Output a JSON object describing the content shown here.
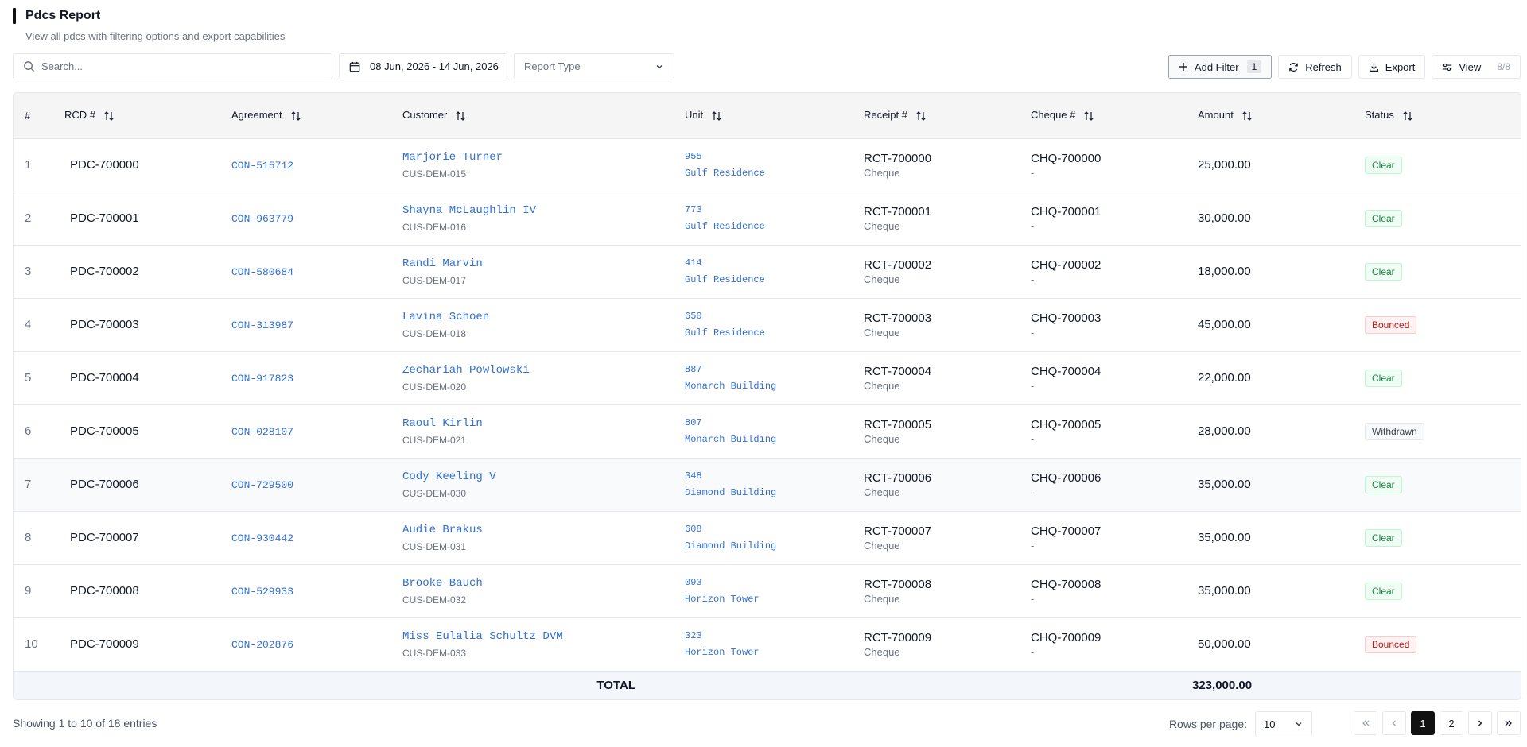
{
  "page": {
    "title": "Pdcs Report",
    "subtitle": "View all pdcs with filtering options and export capabilities"
  },
  "toolbar": {
    "search_placeholder": "Search...",
    "date_range": "08 Jun, 2026 - 14 Jun, 2026",
    "report_type_placeholder": "Report Type",
    "add_filter_label": "Add Filter",
    "filter_count": "1",
    "refresh_label": "Refresh",
    "export_label": "Export",
    "view_label": "View",
    "view_count": "8/8"
  },
  "table": {
    "headers": {
      "num": "#",
      "rcd": "RCD #",
      "agreement": "Agreement",
      "customer": "Customer",
      "unit": "Unit",
      "receipt": "Receipt #",
      "cheque": "Cheque #",
      "amount": "Amount",
      "status": "Status"
    },
    "rows": [
      {
        "num": "1",
        "rcd": "PDC-700000",
        "agreement": "CON-515712",
        "customer_name": "Marjorie Turner",
        "customer_code": "CUS-DEM-015",
        "unit_no": "955",
        "unit_building": "Gulf Residence",
        "receipt": "RCT-700000",
        "receipt_type": "Cheque",
        "cheque": "CHQ-700000",
        "cheque_sub": "-",
        "amount": "25,000.00",
        "status": "Clear"
      },
      {
        "num": "2",
        "rcd": "PDC-700001",
        "agreement": "CON-963779",
        "customer_name": "Shayna McLaughlin IV",
        "customer_code": "CUS-DEM-016",
        "unit_no": "773",
        "unit_building": "Gulf Residence",
        "receipt": "RCT-700001",
        "receipt_type": "Cheque",
        "cheque": "CHQ-700001",
        "cheque_sub": "-",
        "amount": "30,000.00",
        "status": "Clear"
      },
      {
        "num": "3",
        "rcd": "PDC-700002",
        "agreement": "CON-580684",
        "customer_name": "Randi Marvin",
        "customer_code": "CUS-DEM-017",
        "unit_no": "414",
        "unit_building": "Gulf Residence",
        "receipt": "RCT-700002",
        "receipt_type": "Cheque",
        "cheque": "CHQ-700002",
        "cheque_sub": "-",
        "amount": "18,000.00",
        "status": "Clear"
      },
      {
        "num": "4",
        "rcd": "PDC-700003",
        "agreement": "CON-313987",
        "customer_name": "Lavina Schoen",
        "customer_code": "CUS-DEM-018",
        "unit_no": "650",
        "unit_building": "Gulf Residence",
        "receipt": "RCT-700003",
        "receipt_type": "Cheque",
        "cheque": "CHQ-700003",
        "cheque_sub": "-",
        "amount": "45,000.00",
        "status": "Bounced"
      },
      {
        "num": "5",
        "rcd": "PDC-700004",
        "agreement": "CON-917823",
        "customer_name": "Zechariah Powlowski",
        "customer_code": "CUS-DEM-020",
        "unit_no": "887",
        "unit_building": "Monarch Building",
        "receipt": "RCT-700004",
        "receipt_type": "Cheque",
        "cheque": "CHQ-700004",
        "cheque_sub": "-",
        "amount": "22,000.00",
        "status": "Clear"
      },
      {
        "num": "6",
        "rcd": "PDC-700005",
        "agreement": "CON-028107",
        "customer_name": "Raoul Kirlin",
        "customer_code": "CUS-DEM-021",
        "unit_no": "807",
        "unit_building": "Monarch Building",
        "receipt": "RCT-700005",
        "receipt_type": "Cheque",
        "cheque": "CHQ-700005",
        "cheque_sub": "-",
        "amount": "28,000.00",
        "status": "Withdrawn"
      },
      {
        "num": "7",
        "rcd": "PDC-700006",
        "agreement": "CON-729500",
        "customer_name": "Cody Keeling V",
        "customer_code": "CUS-DEM-030",
        "unit_no": "348",
        "unit_building": "Diamond Building",
        "receipt": "RCT-700006",
        "receipt_type": "Cheque",
        "cheque": "CHQ-700006",
        "cheque_sub": "-",
        "amount": "35,000.00",
        "status": "Clear"
      },
      {
        "num": "8",
        "rcd": "PDC-700007",
        "agreement": "CON-930442",
        "customer_name": "Audie Brakus",
        "customer_code": "CUS-DEM-031",
        "unit_no": "608",
        "unit_building": "Diamond Building",
        "receipt": "RCT-700007",
        "receipt_type": "Cheque",
        "cheque": "CHQ-700007",
        "cheque_sub": "-",
        "amount": "35,000.00",
        "status": "Clear"
      },
      {
        "num": "9",
        "rcd": "PDC-700008",
        "agreement": "CON-529933",
        "customer_name": "Brooke Bauch",
        "customer_code": "CUS-DEM-032",
        "unit_no": "093",
        "unit_building": "Horizon Tower",
        "receipt": "RCT-700008",
        "receipt_type": "Cheque",
        "cheque": "CHQ-700008",
        "cheque_sub": "-",
        "amount": "35,000.00",
        "status": "Clear"
      },
      {
        "num": "10",
        "rcd": "PDC-700009",
        "agreement": "CON-202876",
        "customer_name": "Miss Eulalia Schultz DVM",
        "customer_code": "CUS-DEM-033",
        "unit_no": "323",
        "unit_building": "Horizon Tower",
        "receipt": "RCT-700009",
        "receipt_type": "Cheque",
        "cheque": "CHQ-700009",
        "cheque_sub": "-",
        "amount": "50,000.00",
        "status": "Bounced"
      }
    ],
    "total_label": "TOTAL",
    "total_amount": "323,000.00"
  },
  "footer": {
    "showing": "Showing 1 to 10 of 18 entries",
    "rows_per_page_label": "Rows per page:",
    "rows_per_page_value": "10",
    "pages": [
      "1",
      "2"
    ],
    "current_page": "1"
  },
  "colors": {
    "link": "#2f6fd6",
    "clear": "#15803d",
    "bounced": "#b91c1c",
    "active_page": "#111111"
  }
}
